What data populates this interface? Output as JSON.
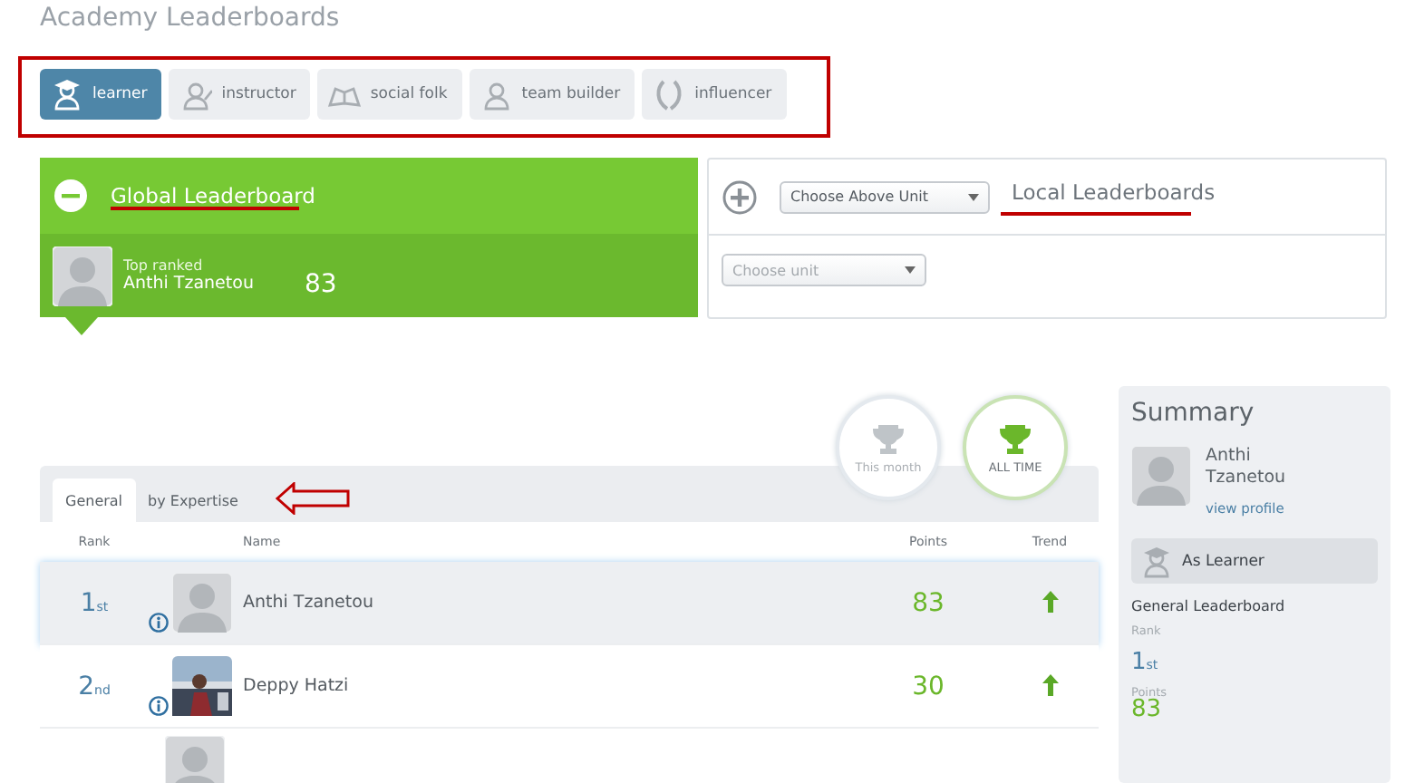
{
  "title": "Academy Leaderboards",
  "roles": [
    {
      "label": "learner",
      "selected": true
    },
    {
      "label": "instructor",
      "selected": false
    },
    {
      "label": "social folk",
      "selected": false
    },
    {
      "label": "team builder",
      "selected": false
    },
    {
      "label": "influencer",
      "selected": false
    }
  ],
  "global": {
    "title": "Global Leaderboard",
    "expanded": true,
    "top_label": "Top ranked",
    "top_name": "Anthi Tzanetou",
    "top_points": "83"
  },
  "local": {
    "title": "Local Leaderboards",
    "expanded": false,
    "unit_select": "Choose Above Unit",
    "sub_select_placeholder": "Choose unit"
  },
  "periods": [
    {
      "label": "This month",
      "selected": false
    },
    {
      "label": "ALL TIME",
      "selected": true
    }
  ],
  "tabs": [
    {
      "label": "General",
      "selected": true
    },
    {
      "label": "by Expertise",
      "selected": false
    }
  ],
  "columns": [
    "Rank",
    "Name",
    "Points",
    "Trend"
  ],
  "rows": [
    {
      "rank": "1",
      "suffix": "st",
      "name": "Anthi Tzanetou",
      "points": "83",
      "rising": true,
      "photo": false,
      "selected": true
    },
    {
      "rank": "2",
      "suffix": "nd",
      "name": "Deppy Hatzi",
      "points": "30",
      "rising": true,
      "photo": true,
      "selected": false
    }
  ],
  "summary": {
    "title": "Summary",
    "name": "Anthi Tzanetou",
    "link": "view profile",
    "role": "As Learner",
    "board": "General Leaderboard",
    "rank_label": "Rank",
    "rank": "1",
    "suffix": "st",
    "points_label": "Points",
    "points": "83"
  }
}
